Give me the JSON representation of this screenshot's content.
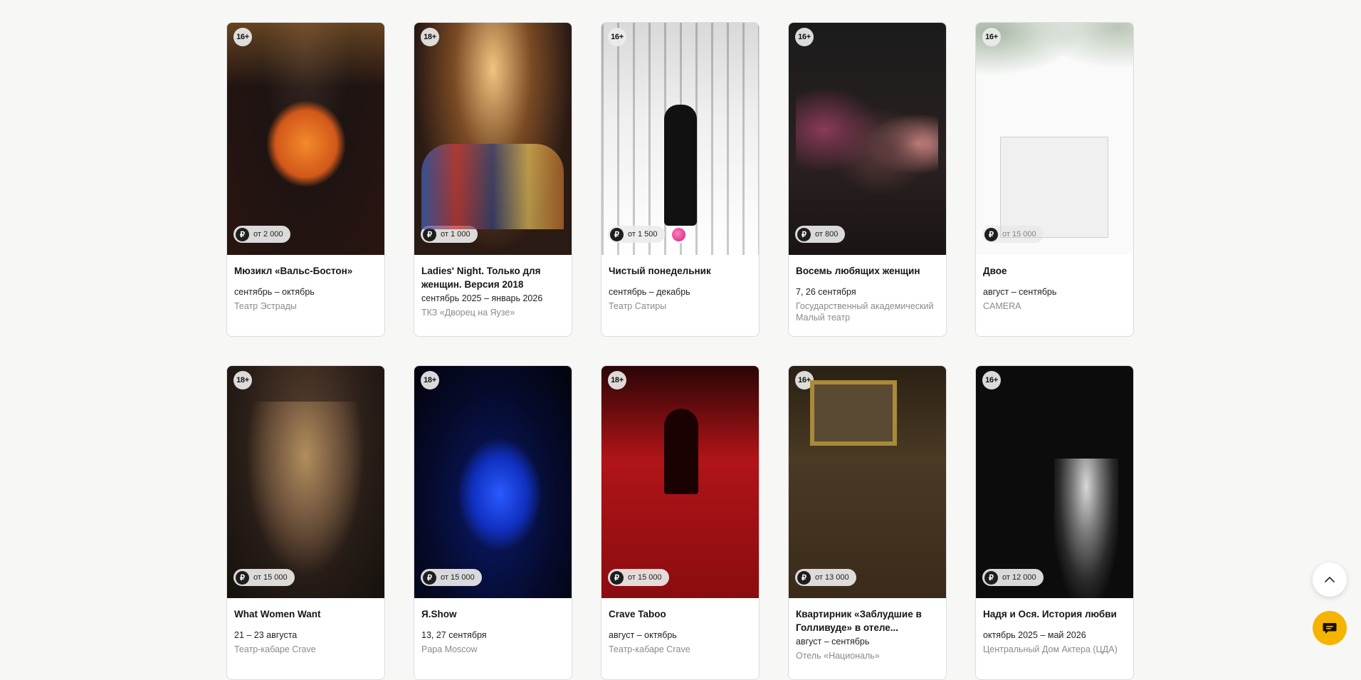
{
  "events": [
    {
      "age": "16+",
      "price": "от 2 000",
      "title": "Мюзикл «Вальс-Бостон»",
      "dates": "сентябрь – октябрь",
      "venue": "Театр Эстрады"
    },
    {
      "age": "18+",
      "price": "от 1 000",
      "title": "Ladies' Night. Только для женщин. Версия 2018",
      "dates": "сентябрь 2025 – январь 2026",
      "venue": "ТКЗ «Дворец на Яузе»"
    },
    {
      "age": "16+",
      "price": "от 1 500",
      "title": "Чистый понедельник",
      "dates": "сентябрь – декабрь",
      "venue": "Театр Сатиры"
    },
    {
      "age": "16+",
      "price": "от 800",
      "title": "Восемь любящих женщин",
      "dates": "7, 26 сентября",
      "venue": "Государственный академический Малый театр"
    },
    {
      "age": "16+",
      "price": "от 15 000",
      "title": "Двое",
      "dates": "август – сентябрь",
      "venue": "CAMERA"
    },
    {
      "age": "18+",
      "price": "от 15 000",
      "title": "What Women Want",
      "dates": "21 – 23 августа",
      "venue": "Театр-кабаре Crave"
    },
    {
      "age": "18+",
      "price": "от 15 000",
      "title": "Я.Show",
      "dates": "13, 27 сентября",
      "venue": "Papa Moscow"
    },
    {
      "age": "18+",
      "price": "от 15 000",
      "title": "Crave Taboo",
      "dates": "август – октябрь",
      "venue": "Театр-кабаре Crave"
    },
    {
      "age": "16+",
      "price": "от 13 000",
      "title": "Квартирник «Заблудшие в Голливуде» в отеле...",
      "dates": "август – сентябрь",
      "venue": "Отель «Националь»"
    },
    {
      "age": "16+",
      "price": "от 12 000",
      "title": "Надя и Ося. История любви",
      "dates": "октябрь 2025 – май 2026",
      "venue": "Центральный Дом Актера (ЦДА)"
    }
  ],
  "currency_symbol": "₽",
  "icons": {
    "scroll_top": "chevron-up-icon",
    "chat": "chat-bubble-icon",
    "promo": "promo-badge-icon"
  },
  "colors": {
    "accent": "#f5b400",
    "page_bg": "#f7f7f5"
  }
}
